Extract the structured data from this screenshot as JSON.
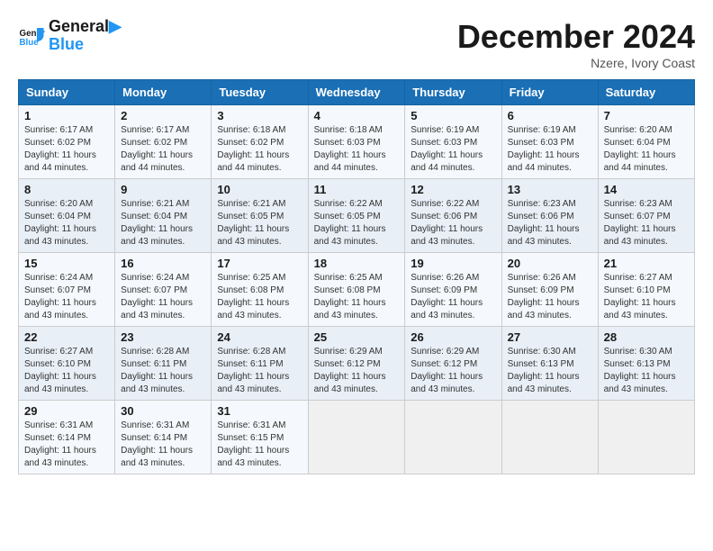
{
  "header": {
    "logo_general": "General",
    "logo_blue": "Blue",
    "title": "December 2024",
    "subtitle": "Nzere, Ivory Coast"
  },
  "days_of_week": [
    "Sunday",
    "Monday",
    "Tuesday",
    "Wednesday",
    "Thursday",
    "Friday",
    "Saturday"
  ],
  "weeks": [
    [
      {
        "day": "1",
        "sunrise": "6:17 AM",
        "sunset": "6:02 PM",
        "daylight": "11 hours and 44 minutes."
      },
      {
        "day": "2",
        "sunrise": "6:17 AM",
        "sunset": "6:02 PM",
        "daylight": "11 hours and 44 minutes."
      },
      {
        "day": "3",
        "sunrise": "6:18 AM",
        "sunset": "6:02 PM",
        "daylight": "11 hours and 44 minutes."
      },
      {
        "day": "4",
        "sunrise": "6:18 AM",
        "sunset": "6:03 PM",
        "daylight": "11 hours and 44 minutes."
      },
      {
        "day": "5",
        "sunrise": "6:19 AM",
        "sunset": "6:03 PM",
        "daylight": "11 hours and 44 minutes."
      },
      {
        "day": "6",
        "sunrise": "6:19 AM",
        "sunset": "6:03 PM",
        "daylight": "11 hours and 44 minutes."
      },
      {
        "day": "7",
        "sunrise": "6:20 AM",
        "sunset": "6:04 PM",
        "daylight": "11 hours and 44 minutes."
      }
    ],
    [
      {
        "day": "8",
        "sunrise": "6:20 AM",
        "sunset": "6:04 PM",
        "daylight": "11 hours and 43 minutes."
      },
      {
        "day": "9",
        "sunrise": "6:21 AM",
        "sunset": "6:04 PM",
        "daylight": "11 hours and 43 minutes."
      },
      {
        "day": "10",
        "sunrise": "6:21 AM",
        "sunset": "6:05 PM",
        "daylight": "11 hours and 43 minutes."
      },
      {
        "day": "11",
        "sunrise": "6:22 AM",
        "sunset": "6:05 PM",
        "daylight": "11 hours and 43 minutes."
      },
      {
        "day": "12",
        "sunrise": "6:22 AM",
        "sunset": "6:06 PM",
        "daylight": "11 hours and 43 minutes."
      },
      {
        "day": "13",
        "sunrise": "6:23 AM",
        "sunset": "6:06 PM",
        "daylight": "11 hours and 43 minutes."
      },
      {
        "day": "14",
        "sunrise": "6:23 AM",
        "sunset": "6:07 PM",
        "daylight": "11 hours and 43 minutes."
      }
    ],
    [
      {
        "day": "15",
        "sunrise": "6:24 AM",
        "sunset": "6:07 PM",
        "daylight": "11 hours and 43 minutes."
      },
      {
        "day": "16",
        "sunrise": "6:24 AM",
        "sunset": "6:07 PM",
        "daylight": "11 hours and 43 minutes."
      },
      {
        "day": "17",
        "sunrise": "6:25 AM",
        "sunset": "6:08 PM",
        "daylight": "11 hours and 43 minutes."
      },
      {
        "day": "18",
        "sunrise": "6:25 AM",
        "sunset": "6:08 PM",
        "daylight": "11 hours and 43 minutes."
      },
      {
        "day": "19",
        "sunrise": "6:26 AM",
        "sunset": "6:09 PM",
        "daylight": "11 hours and 43 minutes."
      },
      {
        "day": "20",
        "sunrise": "6:26 AM",
        "sunset": "6:09 PM",
        "daylight": "11 hours and 43 minutes."
      },
      {
        "day": "21",
        "sunrise": "6:27 AM",
        "sunset": "6:10 PM",
        "daylight": "11 hours and 43 minutes."
      }
    ],
    [
      {
        "day": "22",
        "sunrise": "6:27 AM",
        "sunset": "6:10 PM",
        "daylight": "11 hours and 43 minutes."
      },
      {
        "day": "23",
        "sunrise": "6:28 AM",
        "sunset": "6:11 PM",
        "daylight": "11 hours and 43 minutes."
      },
      {
        "day": "24",
        "sunrise": "6:28 AM",
        "sunset": "6:11 PM",
        "daylight": "11 hours and 43 minutes."
      },
      {
        "day": "25",
        "sunrise": "6:29 AM",
        "sunset": "6:12 PM",
        "daylight": "11 hours and 43 minutes."
      },
      {
        "day": "26",
        "sunrise": "6:29 AM",
        "sunset": "6:12 PM",
        "daylight": "11 hours and 43 minutes."
      },
      {
        "day": "27",
        "sunrise": "6:30 AM",
        "sunset": "6:13 PM",
        "daylight": "11 hours and 43 minutes."
      },
      {
        "day": "28",
        "sunrise": "6:30 AM",
        "sunset": "6:13 PM",
        "daylight": "11 hours and 43 minutes."
      }
    ],
    [
      {
        "day": "29",
        "sunrise": "6:31 AM",
        "sunset": "6:14 PM",
        "daylight": "11 hours and 43 minutes."
      },
      {
        "day": "30",
        "sunrise": "6:31 AM",
        "sunset": "6:14 PM",
        "daylight": "11 hours and 43 minutes."
      },
      {
        "day": "31",
        "sunrise": "6:31 AM",
        "sunset": "6:15 PM",
        "daylight": "11 hours and 43 minutes."
      },
      null,
      null,
      null,
      null
    ]
  ]
}
